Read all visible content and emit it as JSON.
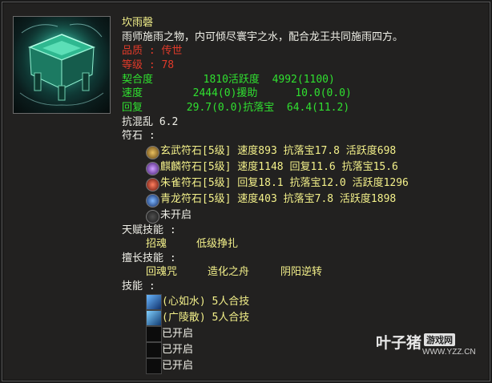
{
  "item": {
    "name": "坎雨磬",
    "description": "雨师施雨之物，内可倾尽寰宇之水，配合龙王共同施雨四方。",
    "quality": "品质 : 传世",
    "level": "等级 : 78",
    "stats": [
      "契合度        1810活跃度  4992(1100)",
      "速度        2444(0)援助      10.0(0.0)",
      "回复       29.7(0.0)抗落宝  64.4(11.2)",
      "抗混乱 6.2"
    ]
  },
  "runes": {
    "header": "符石 :",
    "items": [
      {
        "name": "玄武符石[5级]",
        "stats": " 速度893 抗落宝17.8 活跃度698",
        "icon": "xuanwu-rune-icon",
        "color": "#b08a40"
      },
      {
        "name": "麒麟符石[5级]",
        "stats": " 速度1148 回复11.6 抗落宝15.6",
        "icon": "qilin-rune-icon",
        "color": "#7a3fb0"
      },
      {
        "name": "朱雀符石[5级]",
        "stats": " 回复18.1 抗落宝12.0 活跃度1296",
        "icon": "zhuque-rune-icon",
        "color": "#b03020"
      },
      {
        "name": "青龙符石[5级]",
        "stats": " 速度403 抗落宝7.8 活跃度1898",
        "icon": "qinglong-rune-icon",
        "color": "#3060b0"
      },
      {
        "name": "未开启",
        "stats": "",
        "icon": "locked-rune-icon",
        "color": "#404040"
      }
    ]
  },
  "talent": {
    "header": "天赋技能 :",
    "skills": [
      "招魂",
      "低级挣扎"
    ]
  },
  "specialty": {
    "header": "擅长技能 :",
    "skills": [
      "回魂咒",
      "造化之舟",
      "阴阳逆转"
    ]
  },
  "skills": {
    "header": "技能 :",
    "items": [
      {
        "label": "(心如水) 5人合技",
        "icon": "xinrushui-skill-icon",
        "filled": true
      },
      {
        "label": "(广陵散) 5人合技",
        "icon": "guanglingsan-skill-icon",
        "filled": true
      },
      {
        "label": "已开启",
        "icon": "empty-skill-slot-icon",
        "filled": false
      },
      {
        "label": "已开启",
        "icon": "empty-skill-slot-icon",
        "filled": false
      },
      {
        "label": "已开启",
        "icon": "empty-skill-slot-icon",
        "filled": false
      }
    ]
  },
  "watermark": {
    "brand": "叶子猪",
    "badge": "游戏网",
    "url": "WWW.YZZ.CN"
  }
}
